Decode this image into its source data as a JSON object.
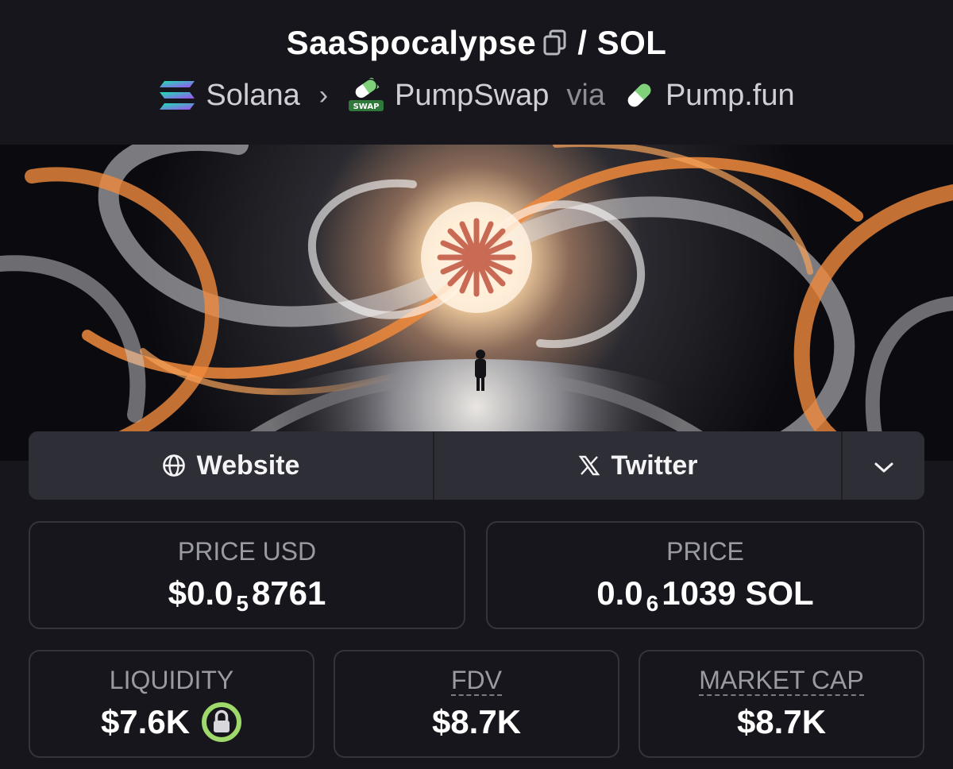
{
  "header": {
    "token_name": "SaaSpocalypse",
    "pair_separator": "/",
    "quote_symbol": "SOL",
    "chain": "Solana",
    "dex": "PumpSwap",
    "via_label": "via",
    "launchpad": "Pump.fun",
    "dex_icon_text": "SWAP"
  },
  "links": {
    "website_label": "Website",
    "twitter_label": "Twitter",
    "twitter_glyph": "𝕏"
  },
  "stats": {
    "price_usd": {
      "label": "PRICE USD",
      "prefix": "$0.0",
      "zeros": "5",
      "digits": "8761"
    },
    "price_sol": {
      "label": "PRICE",
      "prefix": "0.0",
      "zeros": "6",
      "digits": "1039 SOL"
    },
    "liquidity": {
      "label": "LIQUIDITY",
      "value": "$7.6K"
    },
    "fdv": {
      "label": "FDV",
      "value": "$8.7K"
    },
    "market_cap": {
      "label": "MARKET CAP",
      "value": "$8.7K"
    }
  },
  "colors": {
    "background": "#16161c",
    "button": "#2e2e36",
    "lock_ring": "#9fd86b",
    "banner_orange": "#f08a3c",
    "logo_coral": "#c96a55"
  }
}
